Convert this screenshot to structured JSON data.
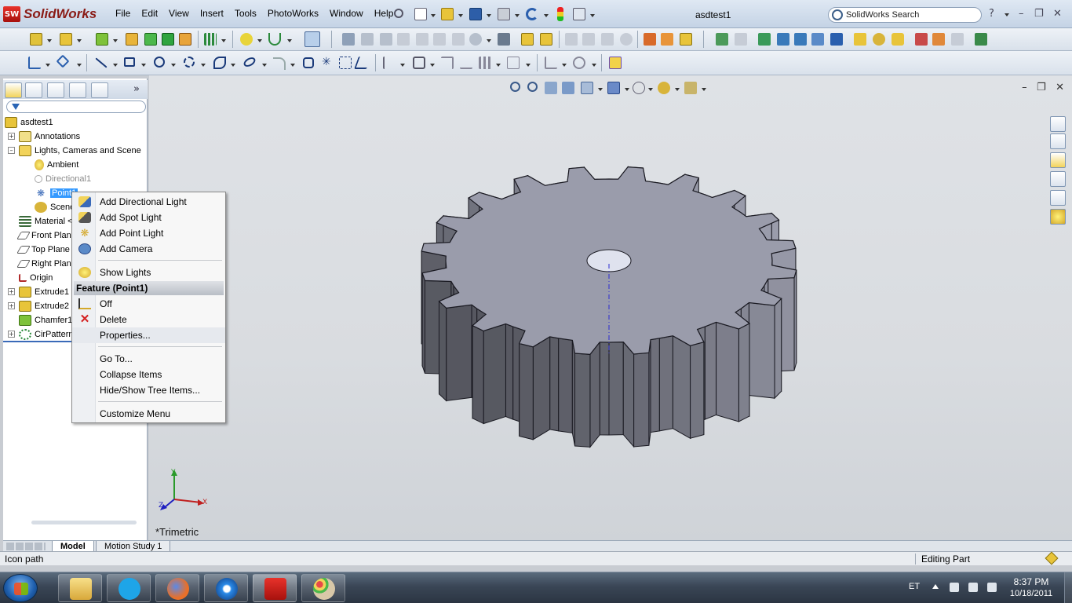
{
  "app": {
    "logo_text": "SolidWorks",
    "logo_badge": "SW",
    "document_title": "asdtest1",
    "search_placeholder": "SolidWorks Search",
    "help_glyph": "?",
    "menu": [
      "File",
      "Edit",
      "View",
      "Insert",
      "Tools",
      "PhotoWorks",
      "Window",
      "Help"
    ]
  },
  "feature_tree": {
    "root": "asdtest1",
    "items": [
      {
        "label": "Annotations",
        "icon": "annotations-icon"
      },
      {
        "label": "Lights, Cameras and Scene",
        "icon": "lights-folder-icon"
      },
      {
        "label": "Ambient",
        "icon": "ambient-light-icon"
      },
      {
        "label": "Directional1",
        "icon": "directional-light-icon"
      },
      {
        "label": "Point1",
        "icon": "point-light-icon"
      },
      {
        "label": "Scene",
        "icon": "scene-icon"
      },
      {
        "label": "Material <",
        "icon": "material-icon"
      },
      {
        "label": "Front Plan",
        "icon": "plane-icon"
      },
      {
        "label": "Top Plane",
        "icon": "plane-icon"
      },
      {
        "label": "Right Plan",
        "icon": "plane-icon"
      },
      {
        "label": "Origin",
        "icon": "origin-icon"
      },
      {
        "label": "Extrude1",
        "icon": "extrude-icon"
      },
      {
        "label": "Extrude2",
        "icon": "extrude-icon"
      },
      {
        "label": "Chamfer1",
        "icon": "chamfer-icon"
      },
      {
        "label": "CirPattern",
        "icon": "pattern-icon"
      }
    ]
  },
  "context_menu": {
    "items": [
      {
        "label": "Add Directional Light",
        "icon": "directional-light-icon"
      },
      {
        "label": "Add Spot Light",
        "icon": "spot-light-icon"
      },
      {
        "label": "Add Point Light",
        "icon": "point-light-icon"
      },
      {
        "label": "Add Camera",
        "icon": "camera-icon"
      }
    ],
    "show_lights": "Show Lights",
    "section_header": "Feature (Point1)",
    "off": "Off",
    "delete": "Delete",
    "properties": "Properties...",
    "go_to": "Go To...",
    "collapse": "Collapse Items",
    "hide_show": "Hide/Show Tree Items...",
    "customize": "Customize Menu"
  },
  "viewport": {
    "orientation": "*Trimetric",
    "axis_x": "X",
    "axis_y": "Y",
    "axis_z": "Z",
    "model_color": "#9a9cab"
  },
  "bottom_tabs": [
    "Model",
    "Motion Study 1"
  ],
  "status": {
    "left": "Icon path",
    "right": "Editing Part"
  },
  "taskbar": {
    "language": "ET",
    "time": "8:37 PM",
    "date": "10/18/2011"
  },
  "colors": {
    "accent": "#3399ff",
    "sw_red": "#c0201a"
  }
}
